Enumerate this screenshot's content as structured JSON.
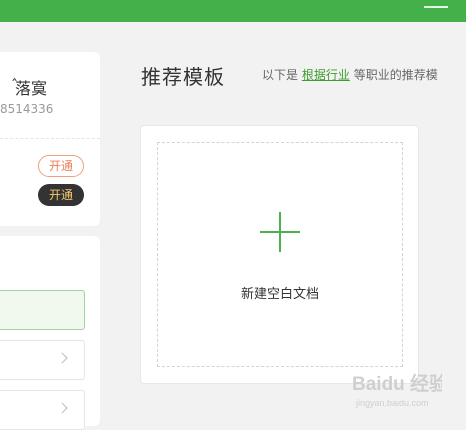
{
  "profile": {
    "name": "落寞",
    "user_id": "8514336",
    "open_label_1": "开通",
    "open_label_2": "开通"
  },
  "main": {
    "title": "推荐模板",
    "desc_prefix": "以下是",
    "desc_link": "根据行业",
    "desc_suffix": "等职业的推荐模",
    "new_blank_label": "新建空白文档"
  },
  "colors": {
    "brand_green": "#43b04a",
    "plus_green": "#4caf50",
    "link_green": "#3e9c2f",
    "outline_orange": "#e9835b",
    "dark_button": "#333333"
  },
  "watermark": {
    "text": "Baidu 经验",
    "url": "jingyan.baidu.com"
  }
}
